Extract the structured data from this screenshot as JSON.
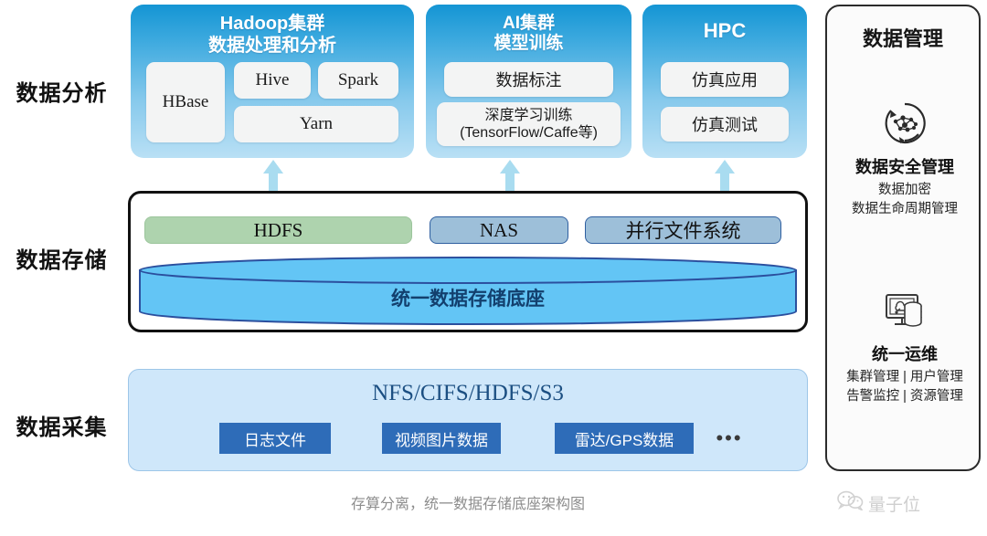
{
  "rows": [
    {
      "label": "数据分析"
    },
    {
      "label": "数据存储"
    },
    {
      "label": "数据采集"
    }
  ],
  "analysis": {
    "hadoop": {
      "title_line1": "Hadoop集群",
      "title_line2": "数据处理和分析",
      "items": [
        {
          "label": "HBase"
        },
        {
          "label": "Hive"
        },
        {
          "label": "Spark"
        },
        {
          "label": "Yarn"
        }
      ]
    },
    "ai": {
      "title_line1": "AI集群",
      "title_line2": "模型训练",
      "items": [
        {
          "label": "数据标注"
        },
        {
          "label_line1": "深度学习训练",
          "label_line2": "(TensorFlow/Caffe等)"
        }
      ]
    },
    "hpc": {
      "title_line1": "HPC",
      "title_line2": "",
      "items": [
        {
          "label": "仿真应用"
        },
        {
          "label": "仿真测试"
        }
      ]
    }
  },
  "storage": {
    "tags": [
      {
        "label": "HDFS",
        "color": "#aed3ae"
      },
      {
        "label": "NAS",
        "color": "#9dbfd9"
      },
      {
        "label": "并行文件系统",
        "color": "#9dbfd9"
      }
    ],
    "cylinder_label": "统一数据存储底座",
    "cylinder_color": "#63c5f5",
    "cylinder_outline": "#2b4f9e"
  },
  "collection": {
    "protocols": "NFS/CIFS/HDFS/S3",
    "sources": [
      {
        "label": "日志文件"
      },
      {
        "label": "视频图片数据"
      },
      {
        "label": "雷达/GPS数据"
      }
    ],
    "ellipsis": "•••",
    "panel_color": "#cfe7fa",
    "tag_color": "#2e6cb8"
  },
  "management": {
    "title": "数据管理",
    "blocks": [
      {
        "icon": "data-network-security-icon",
        "head": "数据安全管理",
        "sub_line1": "数据加密",
        "sub_line2": "数据生命周期管理"
      },
      {
        "icon": "monitor-storage-ops-icon",
        "head": "统一运维",
        "sub_line1": "集群管理 | 用户管理",
        "sub_line2": "告警监控 | 资源管理"
      }
    ]
  },
  "caption": "存算分离，统一数据存储底座架构图",
  "watermark": {
    "icon": "wechat-icon",
    "label": "量子位"
  },
  "arrows": {
    "icon": "double-headed-vertical-arrow",
    "color": "#a9dcf0"
  }
}
